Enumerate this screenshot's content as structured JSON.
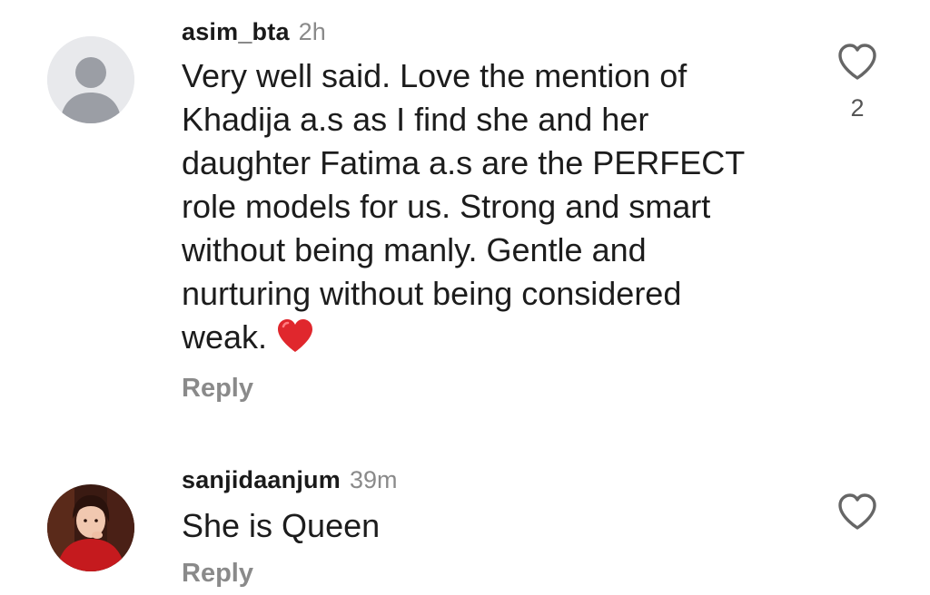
{
  "comments": [
    {
      "username": "asim_bta",
      "time": "2h",
      "text": "Very well said. Love the mention of Khadija a.s as I find she and her daughter Fatima a.s are the PERFECT role models for us. Strong and smart without being manly. Gentle and nurturing without being considered weak.",
      "emoji": "red-heart-emoji",
      "reply_label": "Reply",
      "likes": "2"
    },
    {
      "username": "sanjidaanjum",
      "time": "39m",
      "text": "She is Queen",
      "reply_label": "Reply",
      "likes": ""
    }
  ],
  "colors": {
    "text": "#1c1c1c",
    "muted": "#8a8a8a",
    "heart_red": "#e0272d",
    "avatar_bg": "#e8e9ec",
    "avatar_fg": "#9b9ea5"
  }
}
